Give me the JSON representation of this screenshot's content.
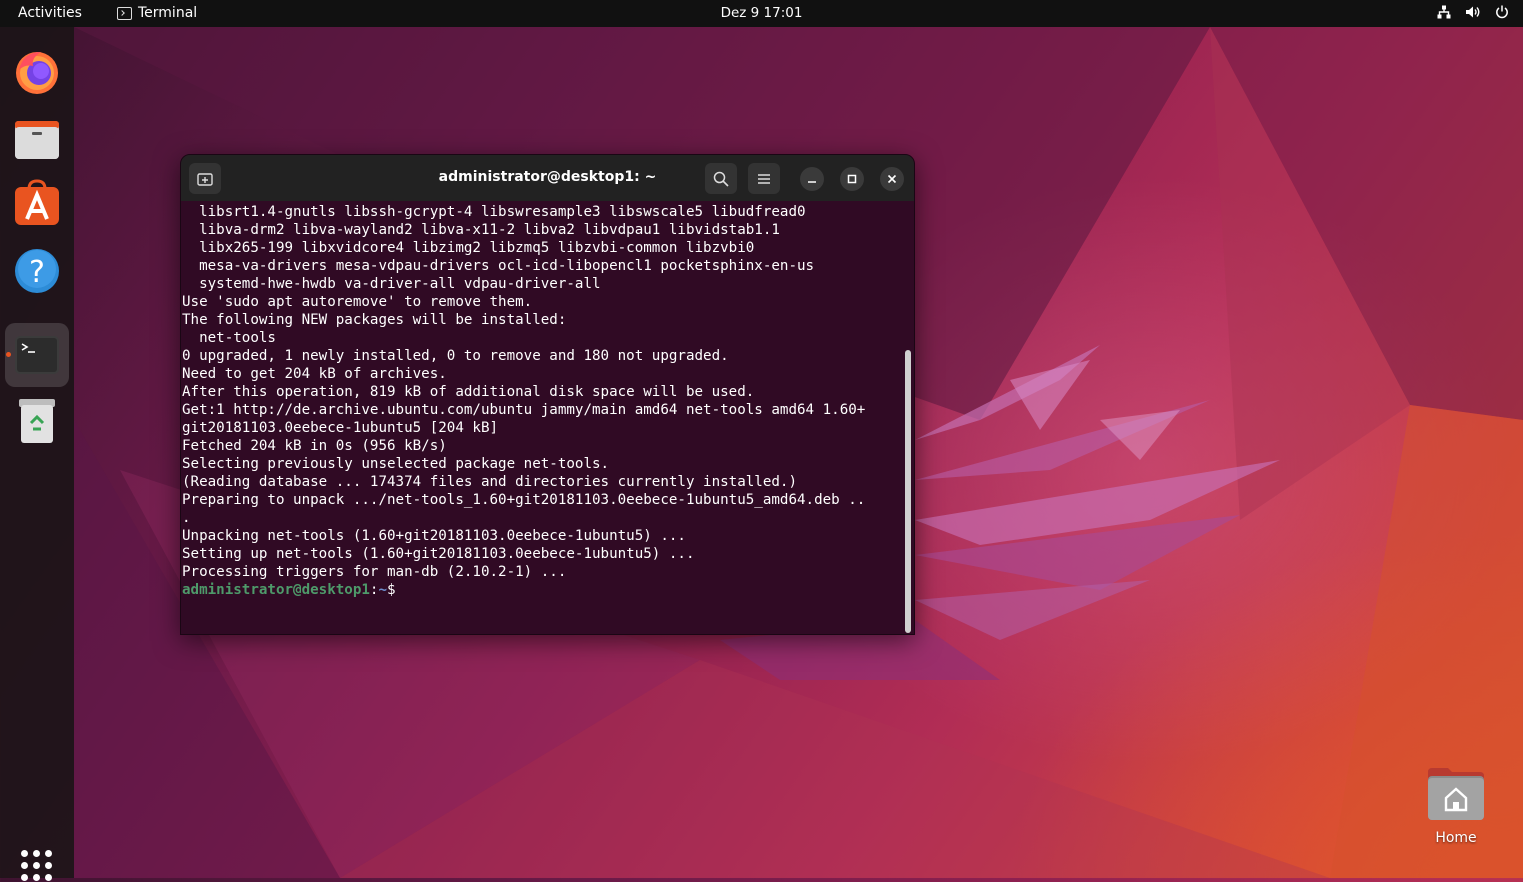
{
  "topbar": {
    "activities_label": "Activities",
    "app_name": "Terminal",
    "clock": "Dez 9  17:01"
  },
  "dock": {
    "items": [
      {
        "name": "Firefox",
        "icon": "firefox-icon"
      },
      {
        "name": "Files",
        "icon": "files-icon"
      },
      {
        "name": "Ubuntu Software",
        "icon": "software-icon"
      },
      {
        "name": "Help",
        "icon": "help-icon"
      },
      {
        "name": "Terminal",
        "icon": "terminal-icon",
        "running": true
      },
      {
        "name": "Trash",
        "icon": "trash-icon"
      }
    ],
    "show_apps_icon": "apps-grid-icon"
  },
  "terminal": {
    "title": "administrator@desktop1: ~",
    "lines": [
      "  libsrt1.4-gnutls libssh-gcrypt-4 libswresample3 libswscale5 libudfread0",
      "  libva-drm2 libva-wayland2 libva-x11-2 libva2 libvdpau1 libvidstab1.1",
      "  libx265-199 libxvidcore4 libzimg2 libzmq5 libzvbi-common libzvbi0",
      "  mesa-va-drivers mesa-vdpau-drivers ocl-icd-libopencl1 pocketsphinx-en-us",
      "  systemd-hwe-hwdb va-driver-all vdpau-driver-all",
      "Use 'sudo apt autoremove' to remove them.",
      "The following NEW packages will be installed:",
      "  net-tools",
      "0 upgraded, 1 newly installed, 0 to remove and 180 not upgraded.",
      "Need to get 204 kB of archives.",
      "After this operation, 819 kB of additional disk space will be used.",
      "Get:1 http://de.archive.ubuntu.com/ubuntu jammy/main amd64 net-tools amd64 1.60+",
      "git20181103.0eebece-1ubuntu5 [204 kB]",
      "Fetched 204 kB in 0s (956 kB/s)",
      "Selecting previously unselected package net-tools.",
      "(Reading database ... 174374 files and directories currently installed.)",
      "Preparing to unpack .../net-tools_1.60+git20181103.0eebece-1ubuntu5_amd64.deb ..",
      ".",
      "Unpacking net-tools (1.60+git20181103.0eebece-1ubuntu5) ...",
      "Setting up net-tools (1.60+git20181103.0eebece-1ubuntu5) ...",
      "Processing triggers for man-db (2.10.2-1) ..."
    ],
    "prompt_user": "administrator@desktop1",
    "prompt_sep": ":",
    "prompt_path": "~",
    "prompt_symbol": "$"
  },
  "desktop": {
    "home_label": "Home"
  },
  "colors": {
    "accent": "#e95420",
    "terminal_bg": "#300a24",
    "prompt_user": "#4e9a6a"
  }
}
